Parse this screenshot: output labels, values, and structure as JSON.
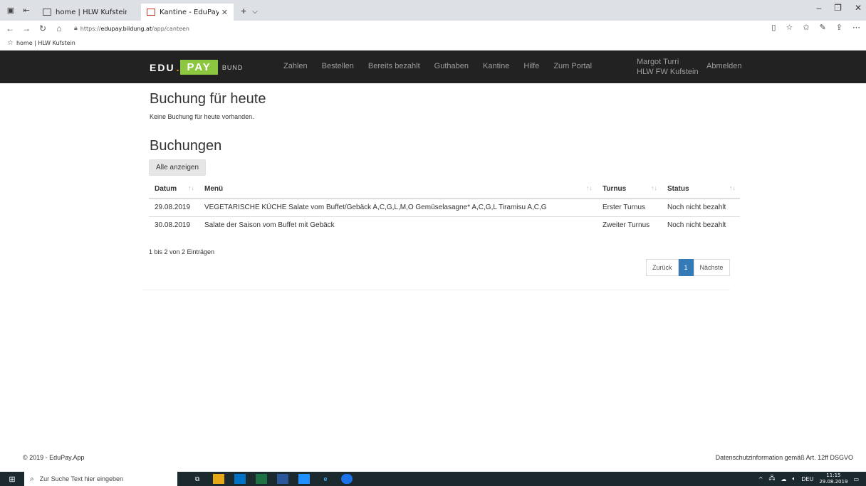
{
  "browser": {
    "tabs": [
      {
        "title": "home | HLW Kufstein",
        "active": false
      },
      {
        "title": "Kantine - EduPay.App",
        "active": true
      }
    ],
    "url_prefix": "https://",
    "url_host": "edupay.bildung.at",
    "url_path": "/app/canteen",
    "favorites": [
      {
        "label": "home | HLW Kufstein"
      }
    ]
  },
  "nav": {
    "brand_edu": "EDU",
    "brand_dot": ".",
    "brand_pay": "PAY",
    "brand_bund": "BUND",
    "links": [
      "Zahlen",
      "Bestellen",
      "Bereits bezahlt",
      "Guthaben",
      "Kantine",
      "Hilfe",
      "Zum Portal"
    ],
    "user_name": "Margot Turri",
    "user_school": "HLW FW Kufstein",
    "logout": "Abmelden"
  },
  "today": {
    "heading": "Buchung für heute",
    "text": "Keine Buchung für heute vorhanden."
  },
  "bookings": {
    "heading": "Buchungen",
    "show_all": "Alle anzeigen",
    "columns": [
      "Datum",
      "Menü",
      "Turnus",
      "Status"
    ],
    "rows": [
      {
        "datum": "29.08.2019",
        "menu": "VEGETARISCHE KÜCHE Salate vom Buffet/Gebäck A,C,G,L,M,O Gemüselasagne* A,C,G,L Tiramisu A,C,G",
        "turnus": "Erster Turnus",
        "status": "Noch nicht bezahlt"
      },
      {
        "datum": "30.08.2019",
        "menu": "Salate der Saison vom Buffet mit Gebäck",
        "turnus": "Zweiter Turnus",
        "status": "Noch nicht bezahlt"
      }
    ],
    "info": "1 bis 2 von 2 Einträgen",
    "pager": {
      "prev": "Zurück",
      "current": "1",
      "next": "Nächste"
    }
  },
  "footer": {
    "copyright": "© 2019 - EduPay.App",
    "privacy": "Datenschutzinformation gemäß Art. 12ff DSGVO"
  },
  "taskbar": {
    "search_placeholder": "Zur Suche Text hier eingeben",
    "lang": "DEU",
    "time": "11:15",
    "date": "29.08.2019"
  },
  "colors": {
    "navbar": "#222222",
    "brand_green": "#8dc63f",
    "brand_orange": "#e5941f",
    "pager_active": "#337ab7"
  }
}
